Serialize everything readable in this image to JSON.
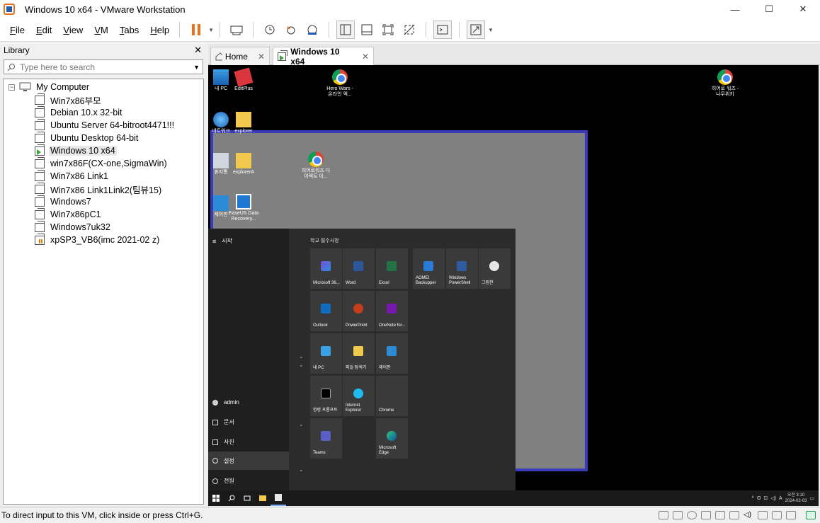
{
  "window": {
    "title": "Windows 10 x64 - VMware Workstation",
    "min": "—",
    "max": "☐",
    "close": "✕"
  },
  "menu": [
    {
      "first": "F",
      "rest": "ile"
    },
    {
      "first": "E",
      "rest": "dit"
    },
    {
      "first": "V",
      "rest": "iew"
    },
    {
      "first": "V",
      "rest": "M"
    },
    {
      "first": "T",
      "rest": "abs"
    },
    {
      "first": "H",
      "rest": "elp"
    }
  ],
  "library": {
    "title": "Library",
    "close": "✕",
    "search_placeholder": "Type here to search",
    "root": "My Computer",
    "vms": [
      "Win7x86부모",
      "Debian 10.x 32-bit",
      "Ubuntu Server 64-bitroot4471!!!",
      "Ubuntu Desktop 64-bit",
      "Windows 10 x64",
      "win7x86F(CX-one,SigmaWin)",
      "Win7x86 Link1",
      "Win7x86 Link1Link2(팀뷰15)",
      "Windows7",
      "Win7x86pC1",
      "Windows7uk32",
      "xpSP3_VB6(imc 2021-02 z)"
    ]
  },
  "tabs": {
    "home": "Home",
    "vm": "Windows 10 x64",
    "close": "✕"
  },
  "desktop": {
    "icons": [
      "내 PC",
      "EditPlus",
      "Hero Wars - 온라인 액...",
      "히어로 워즈 - 나무위키",
      "네트워크",
      "explorer",
      "휴지통",
      "explorerA",
      "히어로워즈 다이렉트 이...",
      "제어판",
      "EaseUS Data Recovery..."
    ]
  },
  "start": {
    "header": "시작",
    "group": "학교 필수사항",
    "left": [
      "admin",
      "문서",
      "사진",
      "설정",
      "전원"
    ],
    "tiles": [
      "Microsoft 36...",
      "Word",
      "Excel",
      "AOMEI Backupper",
      "Windows PowerShell",
      "그림판",
      "Outlook",
      "PowerPoint",
      "OneNote for...",
      "내 PC",
      "파일 탐색기",
      "제어판",
      "명령 프롬프트",
      "Internet Explorer",
      "Chrome",
      "Teams",
      "Microsoft Edge"
    ]
  },
  "taskbar": {
    "time": "오전 3:10",
    "date": "2024-02-03",
    "ime": "A"
  },
  "status": {
    "text": "To direct input to this VM, click inside or press Ctrl+G."
  },
  "colors": {
    "accent": "#3a3ab8",
    "pause": "#e8711c"
  }
}
